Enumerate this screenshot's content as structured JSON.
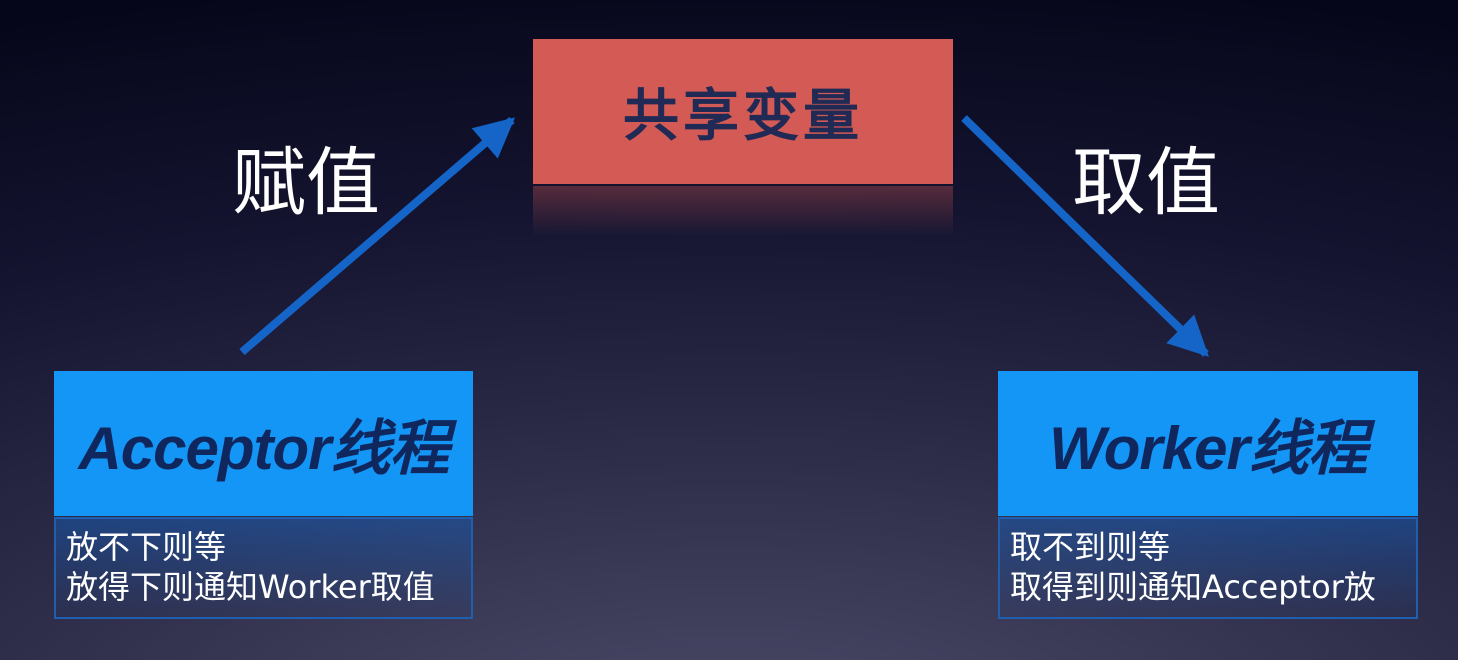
{
  "shared": {
    "title": "共享变量",
    "color": "#d45a55"
  },
  "acceptor": {
    "title": "Acceptor线程",
    "notes": [
      "放不下则等",
      "放得下则通知Worker取值"
    ]
  },
  "worker": {
    "title": "Worker线程",
    "notes": [
      "取不到则等",
      "取得到则通知Acceptor放"
    ]
  },
  "edges": {
    "assign_label": "赋值",
    "take_label": "取值",
    "arrow_color": "#1565c8"
  },
  "colors": {
    "thread_box": "#1496f6",
    "title_text": "#10275e"
  }
}
